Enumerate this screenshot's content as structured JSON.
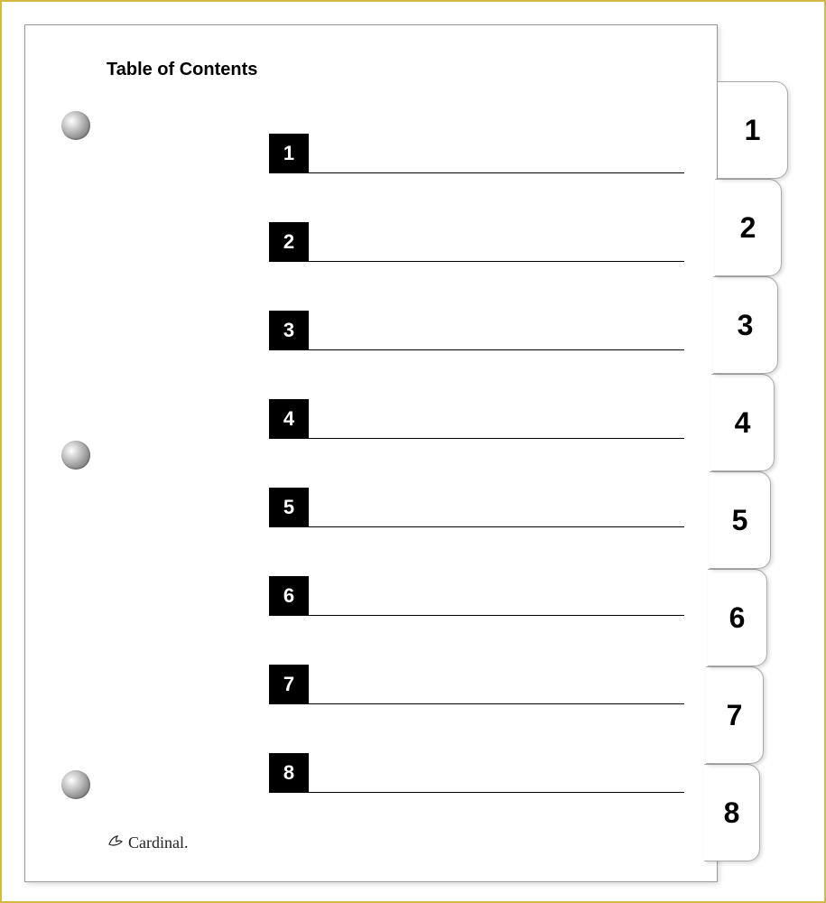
{
  "title": "Table of Contents",
  "rows": [
    {
      "num": "1"
    },
    {
      "num": "2"
    },
    {
      "num": "3"
    },
    {
      "num": "4"
    },
    {
      "num": "5"
    },
    {
      "num": "6"
    },
    {
      "num": "7"
    },
    {
      "num": "8"
    }
  ],
  "tabs": [
    {
      "label": "1"
    },
    {
      "label": "2"
    },
    {
      "label": "3"
    },
    {
      "label": "4"
    },
    {
      "label": "5"
    },
    {
      "label": "6"
    },
    {
      "label": "7"
    },
    {
      "label": "8"
    }
  ],
  "brand": "Cardinal."
}
